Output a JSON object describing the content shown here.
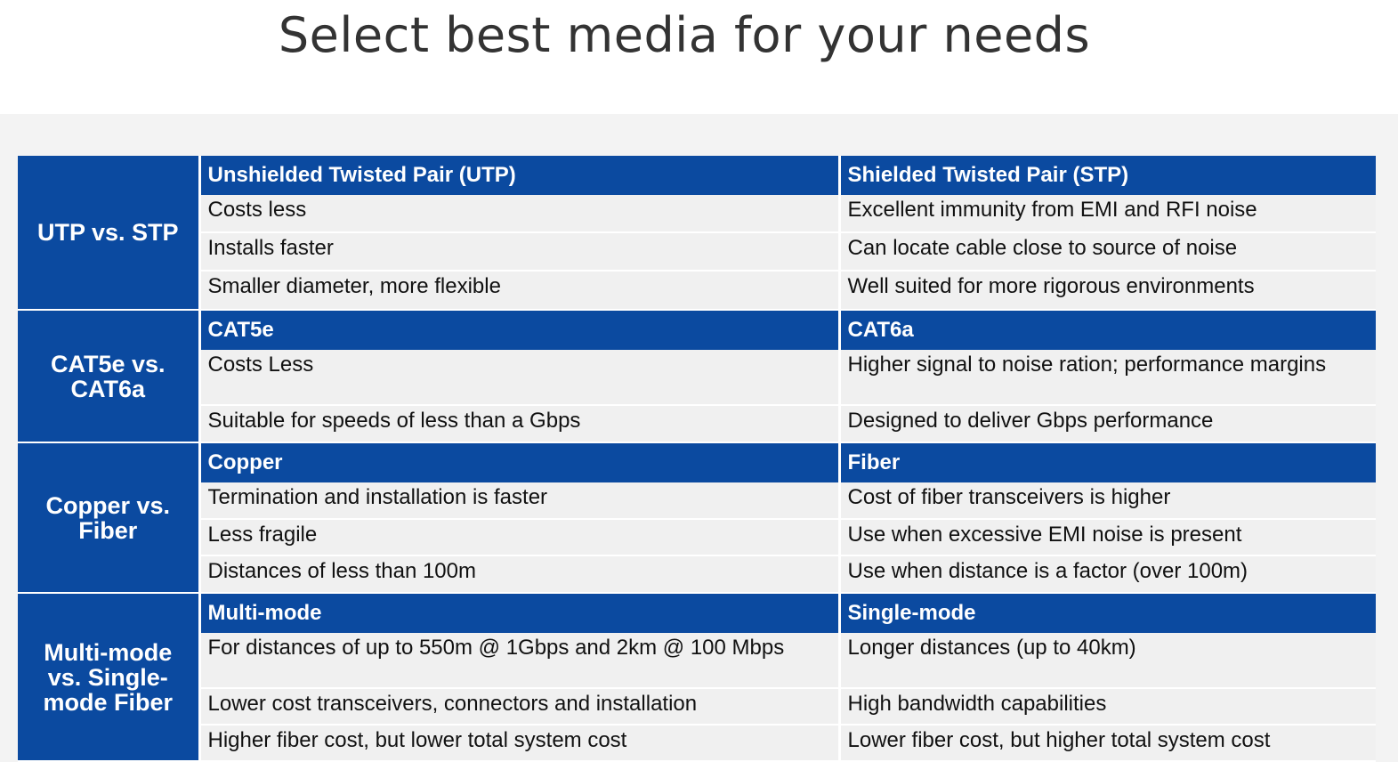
{
  "page": {
    "title": "Select best media for your needs"
  },
  "colors": {
    "header_blue": "#0b4aa0",
    "row_grey": "#f0f0f0",
    "title_grey": "#333333"
  },
  "sections": [
    {
      "label": "UTP vs. STP",
      "left_header": "Unshielded Twisted Pair (UTP)",
      "right_header": "Shielded Twisted Pair (STP)",
      "rows": [
        {
          "left": "Costs less",
          "right": "Excellent immunity from EMI and RFI noise"
        },
        {
          "left": "Installs faster",
          "right": "Can locate cable close to source of noise"
        },
        {
          "left": "Smaller diameter, more flexible",
          "right": "Well suited for more rigorous environments"
        }
      ]
    },
    {
      "label": "CAT5e vs. CAT6a",
      "left_header": "CAT5e",
      "right_header": "CAT6a",
      "rows": [
        {
          "left": "Costs Less",
          "right": "Higher signal to noise ration; performance margins"
        },
        {
          "left": "Suitable for speeds of less than a Gbps",
          "right": "Designed to deliver Gbps performance"
        }
      ]
    },
    {
      "label": "Copper vs. Fiber",
      "left_header": "Copper",
      "right_header": "Fiber",
      "rows": [
        {
          "left": "Termination and installation is faster",
          "right": "Cost of fiber transceivers is higher"
        },
        {
          "left": "Less fragile",
          "right": "Use when excessive EMI noise is present"
        },
        {
          "left": "Distances of less than 100m",
          "right": "Use when distance is a factor (over 100m)"
        }
      ]
    },
    {
      "label": "Multi-mode vs. Single-mode Fiber",
      "left_header": "Multi-mode",
      "right_header": "Single-mode",
      "rows": [
        {
          "left": "For distances of up to 550m @ 1Gbps and 2km @ 100 Mbps",
          "right": "Longer distances (up to 40km)"
        },
        {
          "left": "Lower cost transceivers, connectors and installation",
          "right": "High bandwidth capabilities"
        },
        {
          "left": "Higher fiber cost, but lower total system cost",
          "right": "Lower fiber cost, but higher total system cost"
        }
      ]
    }
  ]
}
